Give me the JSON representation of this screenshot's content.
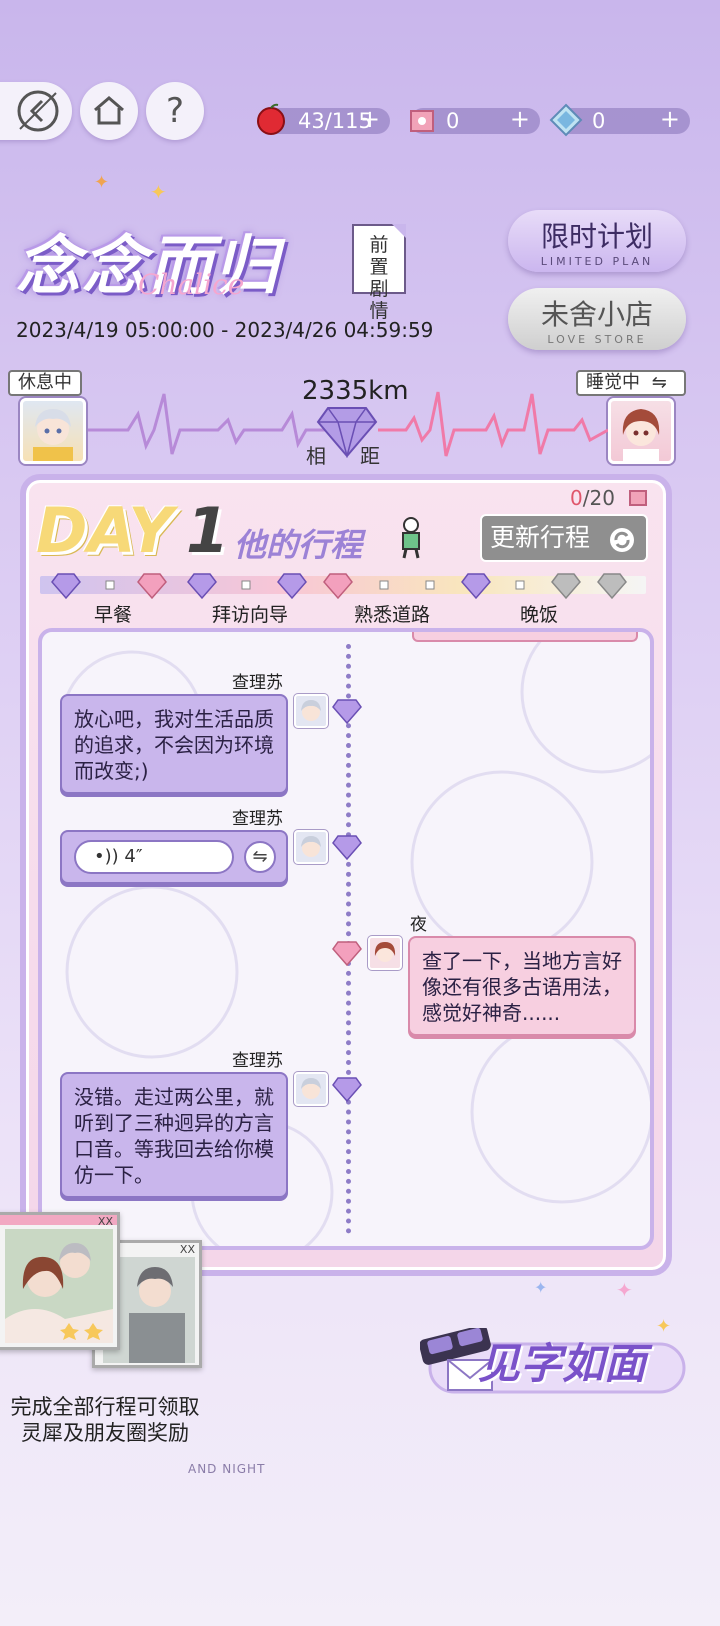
{
  "topbar": {
    "resources": [
      {
        "icon": "apple-icon",
        "value": "43/115",
        "plus": "+"
      },
      {
        "icon": "ticket-icon",
        "value": "0",
        "plus": "+"
      },
      {
        "icon": "crystal-icon",
        "value": "0",
        "plus": "+"
      }
    ],
    "help_label": "?"
  },
  "event": {
    "title": "念念而归",
    "title_script": "Chalice",
    "prev_story": "前置剧情",
    "limited_plan": {
      "label": "限时计划",
      "sub": "LIMITED PLAN"
    },
    "love_store": {
      "label": "未舍小店",
      "sub": "LOVE STORE"
    },
    "date_range": "2023/4/19 05:00:00 - 2023/4/26 04:59:59"
  },
  "distance": {
    "left_status": "休息中",
    "right_status": "睡觉中",
    "right_swap_icon": "⇋",
    "value": "2335km",
    "label_left": "相",
    "label_right": "距"
  },
  "schedule": {
    "day_label": "DAY",
    "day_number": "1",
    "heading": "他的行程",
    "counter_current": "0",
    "counter_total": "/20",
    "update_button": "更新行程",
    "steps": [
      "早餐",
      "拜访向导",
      "熟悉道路",
      "晚饭"
    ]
  },
  "chat": [
    {
      "side": "left",
      "sender": "查理苏",
      "text": "放心吧，我对生活品质的追求，不会因为环境而改变;)"
    },
    {
      "side": "left",
      "sender": "查理苏",
      "voice": "•)) 4″",
      "swap": "⇋"
    },
    {
      "side": "right",
      "sender": "夜",
      "text": "查了一下，当地方言好像还有很多古语用法，感觉好神奇......"
    },
    {
      "side": "left",
      "sender": "查理苏",
      "text": "没错。走过两公里，就听到了三种迥异的方言口音。等我回去给你模仿一下。"
    }
  ],
  "rewards": {
    "card_marks": [
      "XX",
      "XX"
    ],
    "text_line1": "完成全部行程可领取",
    "text_line2": "灵犀及朋友圈奖励",
    "footer": "AND NIGHT"
  },
  "letter": {
    "label": "见字如面"
  },
  "colors": {
    "accent": "#9c82d6",
    "pink": "#e0566c",
    "bubble_left": "#c9b6ec",
    "bubble_right": "#f7cfe0"
  }
}
